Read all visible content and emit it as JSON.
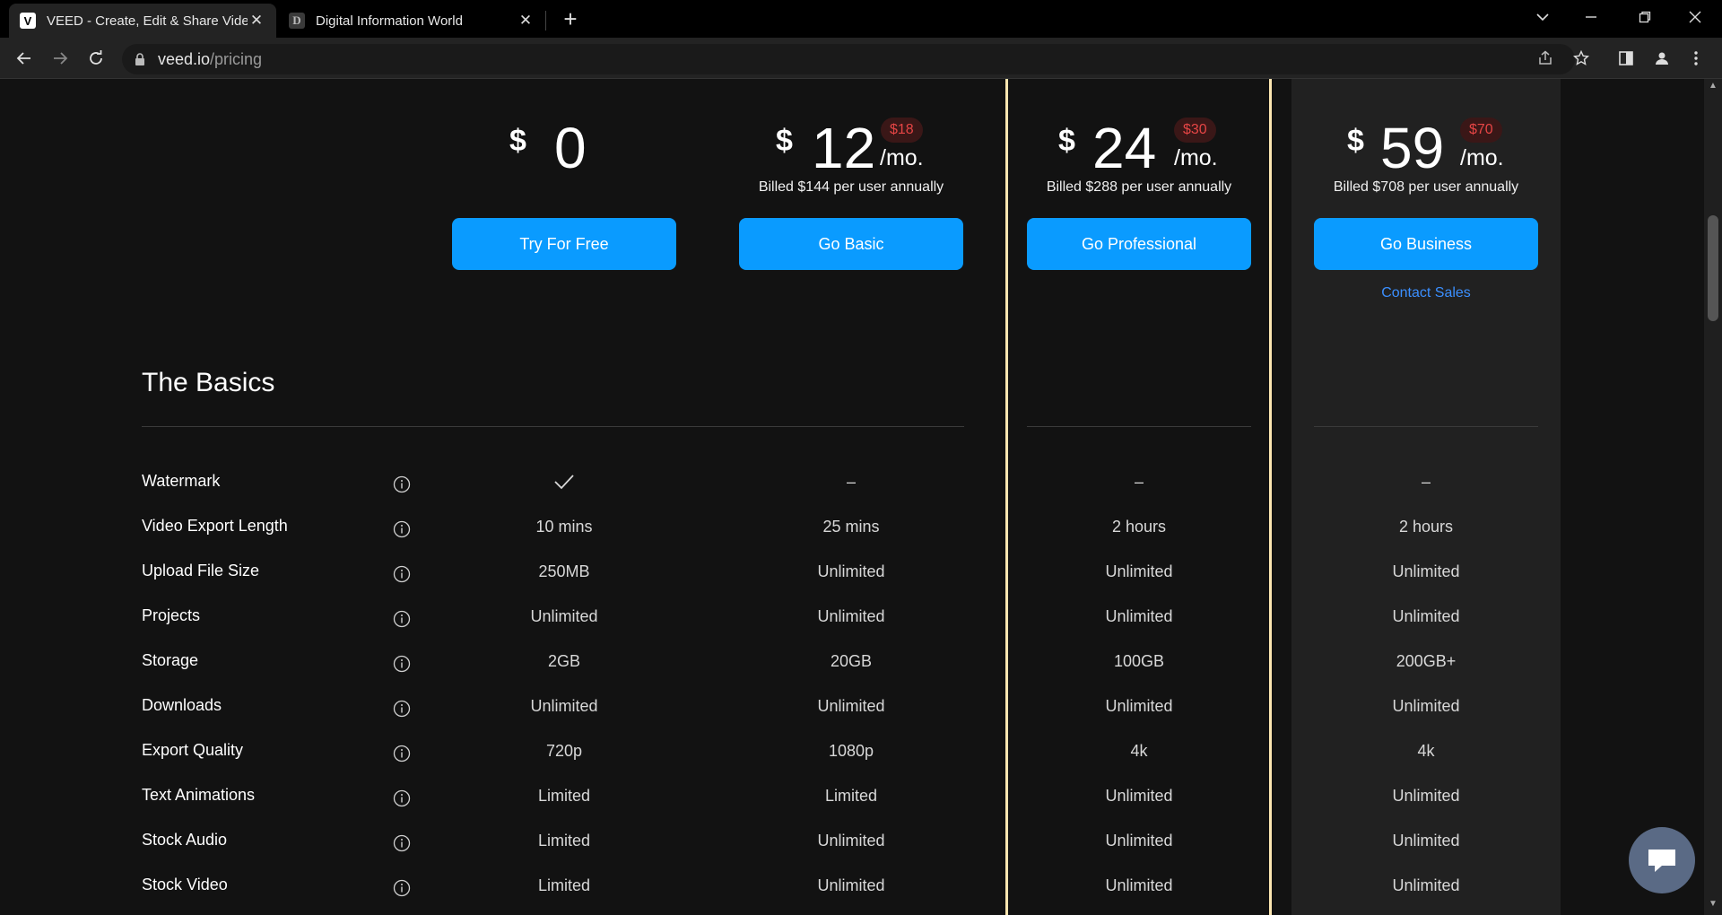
{
  "browser": {
    "tabs": [
      {
        "favicon": "V",
        "title": "VEED - Create, Edit & Share Videos",
        "close": "✕"
      },
      {
        "favicon": "D",
        "title": "Digital Information World",
        "close": "✕"
      }
    ],
    "new_tab": "+",
    "url_domain": "veed.io",
    "url_path": "/pricing"
  },
  "plans": [
    {
      "currency": "$",
      "price": "0",
      "was": "",
      "per": "",
      "billed": "",
      "cta": "Try For Free",
      "extra_link": ""
    },
    {
      "currency": "$",
      "price": "12",
      "was": "$18",
      "per": "/mo.",
      "billed": "Billed $144 per user annually",
      "cta": "Go Basic",
      "extra_link": ""
    },
    {
      "currency": "$",
      "price": "24",
      "was": "$30",
      "per": "/mo.",
      "billed": "Billed $288 per user annually",
      "cta": "Go Professional",
      "extra_link": ""
    },
    {
      "currency": "$",
      "price": "59",
      "was": "$70",
      "per": "/mo.",
      "billed": "Billed $708 per user annually",
      "cta": "Go Business",
      "extra_link": "Contact Sales"
    }
  ],
  "section_title": "The Basics",
  "features": [
    {
      "label": "Watermark",
      "values": [
        "check-icon",
        "–",
        "–",
        "–"
      ]
    },
    {
      "label": "Video Export Length",
      "values": [
        "10 mins",
        "25 mins",
        "2 hours",
        "2 hours"
      ]
    },
    {
      "label": "Upload File Size",
      "values": [
        "250MB",
        "Unlimited",
        "Unlimited",
        "Unlimited"
      ]
    },
    {
      "label": "Projects",
      "values": [
        "Unlimited",
        "Unlimited",
        "Unlimited",
        "Unlimited"
      ]
    },
    {
      "label": "Storage",
      "values": [
        "2GB",
        "20GB",
        "100GB",
        "200GB+"
      ]
    },
    {
      "label": "Downloads",
      "values": [
        "Unlimited",
        "Unlimited",
        "Unlimited",
        "Unlimited"
      ]
    },
    {
      "label": "Export Quality",
      "values": [
        "720p",
        "1080p",
        "4k",
        "4k"
      ]
    },
    {
      "label": "Text Animations",
      "values": [
        "Limited",
        "Limited",
        "Unlimited",
        "Unlimited"
      ]
    },
    {
      "label": "Stock Audio",
      "values": [
        "Limited",
        "Unlimited",
        "Unlimited",
        "Unlimited"
      ]
    },
    {
      "label": "Stock Video",
      "values": [
        "Limited",
        "Unlimited",
        "Unlimited",
        "Unlimited"
      ]
    }
  ],
  "colors": {
    "cta": "#0a9bff",
    "highlight_border": "#fbe5b0",
    "old_price": "#e54545",
    "link": "#3b8fff"
  }
}
